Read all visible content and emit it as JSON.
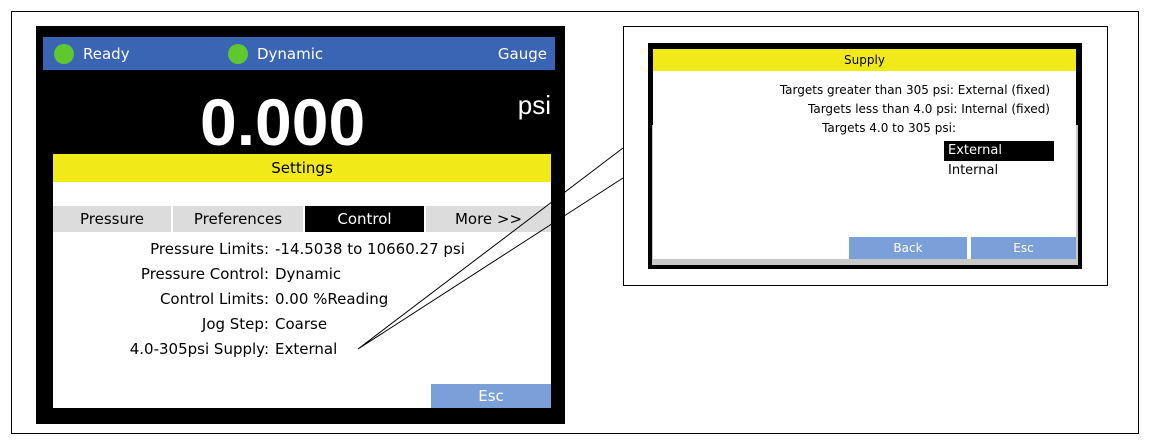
{
  "status_bar": {
    "ready_label": "Ready",
    "mode_label": "Dynamic",
    "gauge_label": "Gauge",
    "led_color": "#5ec82e",
    "bar_color": "#3a64b4"
  },
  "reading": {
    "value": "0.000",
    "unit": "psi"
  },
  "settings": {
    "title": "Settings",
    "tabs": [
      {
        "label": "Pressure"
      },
      {
        "label": "Preferences"
      },
      {
        "label": "Control",
        "active": true
      },
      {
        "label": "More >>"
      }
    ],
    "params": [
      {
        "label": "Pressure Limits:",
        "value": "-14.5038 to 10660.27 psi"
      },
      {
        "label": "Pressure Control:",
        "value": "Dynamic"
      },
      {
        "label": "Control Limits:",
        "value": "0.00 %Reading"
      },
      {
        "label": "Jog Step:",
        "value": "Coarse"
      },
      {
        "label": "4.0-305psi Supply:",
        "value": "External"
      }
    ],
    "esc_label": "Esc"
  },
  "supply_dialog": {
    "title": "Supply",
    "lines": [
      "Targets greater than 305 psi: External (fixed)",
      "Targets less than 4.0 psi: Internal (fixed)",
      "Targets 4.0 to 305 psi:"
    ],
    "options": [
      {
        "label": "External",
        "selected": true
      },
      {
        "label": "Internal",
        "selected": false
      }
    ],
    "back_label": "Back",
    "esc_label": "Esc"
  },
  "colors": {
    "title_yellow": "#f1ea18",
    "button_blue": "#7b9fd8",
    "tab_gray": "#dcdcdc"
  }
}
